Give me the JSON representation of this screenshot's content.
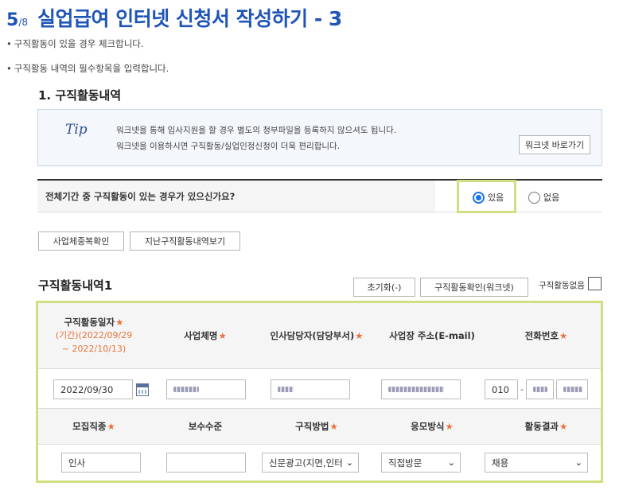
{
  "header": {
    "step": "5",
    "step_total": "/8",
    "title": "실업급여 인터넷 신청서 작성하기 - 3"
  },
  "bullets": [
    "구직활동이 있을 경우 체크합니다.",
    "구직활동 내역의 필수항목을 입력합니다."
  ],
  "section_title": "1. 구직활동내역",
  "tip": {
    "logo": "Tip",
    "line1": "워크넷을 통해 입사지원을 할 경우 별도의 청부파일을 등록하지 않으셔도 됩니다.",
    "line2": "워크넷을 이용하시면 구직활동/실업인정신청이 더욱 편리합니다.",
    "button": "워크넷 바로가기"
  },
  "question": {
    "label": "전체기간 중 구직활동이 있는 경우가 있으신가요?",
    "options": [
      {
        "label": "있음",
        "selected": true
      },
      {
        "label": "없음",
        "selected": false
      }
    ]
  },
  "actions": {
    "btn1": "사업체중복확인",
    "btn2": "지난구직활동내역보기"
  },
  "list": {
    "title": "구직활동내역1",
    "reset": "초기화(-)",
    "confirm": "구직활동확인(워크넷)",
    "none_label": "구직활동없음",
    "required_mark": "★",
    "headers1": {
      "date": "구직활동일자",
      "period_label": "(기간)(2022/09/29",
      "period_end": "~ 2022/10/13)",
      "company": "사업체명",
      "hr": "인사담당자(담당부서)",
      "address": "사업장 주소(E-mail)",
      "phone": "전화번호"
    },
    "row1": {
      "date": "2022/09/30",
      "phone1": "010",
      "dash": "-"
    },
    "headers2": {
      "job": "모집직종",
      "salary": "보수수준",
      "method": "구직방법",
      "apply": "응모방식",
      "result": "활동결과"
    },
    "row2": {
      "job": "인사",
      "salary": "",
      "method": "신문광고(지면,인터",
      "apply": "직접방문",
      "result": "채용"
    }
  },
  "colors": {
    "accent": "#1f54b8",
    "highlight": "#cfe081",
    "required": "#e8743b"
  }
}
